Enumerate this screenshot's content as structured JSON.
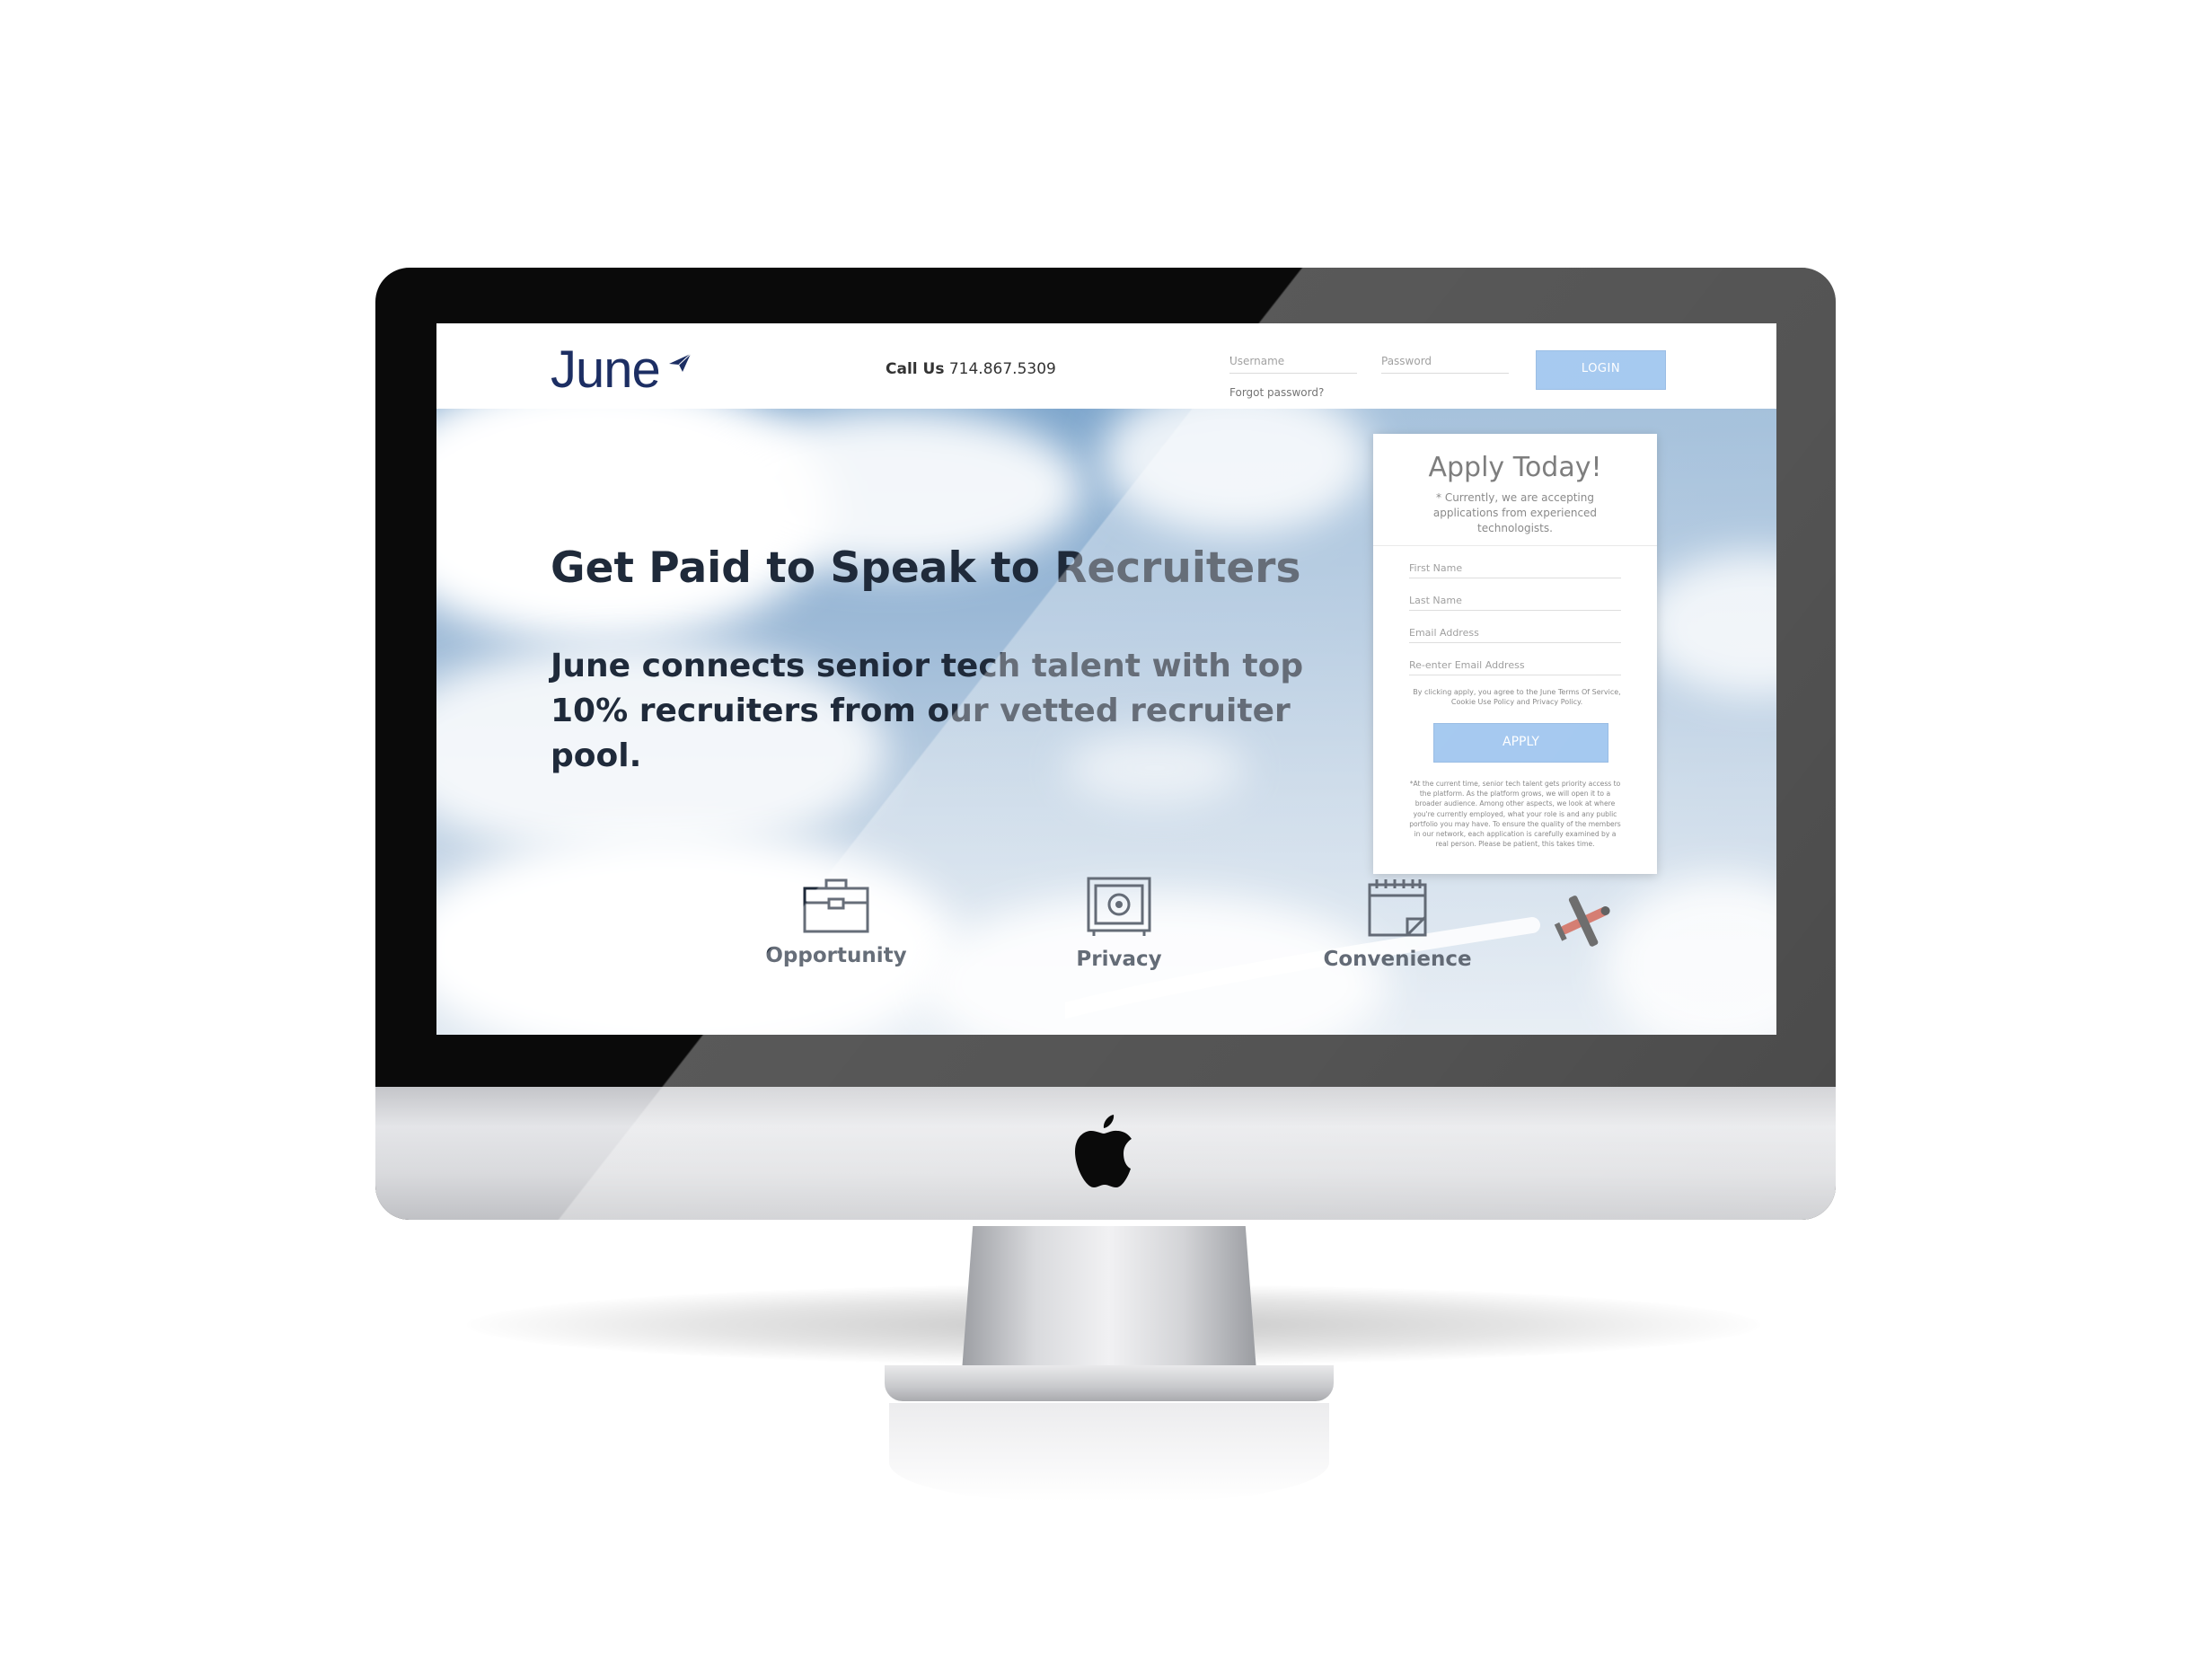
{
  "header": {
    "logo": "June",
    "call_us_label": "Call Us",
    "call_us_number": "714.867.5309",
    "username_placeholder": "Username",
    "password_placeholder": "Password",
    "forgot_password": "Forgot password?",
    "login_label": "LOGIN"
  },
  "hero": {
    "headline": "Get Paid to Speak to Recruiters",
    "subhead": "June connects senior tech talent with top 10% recruiters from our vetted recruiter pool."
  },
  "apply": {
    "title": "Apply Today!",
    "note": "* Currently, we are accepting applications from experienced technologists.",
    "first_name_placeholder": "First Name",
    "last_name_placeholder": "Last Name",
    "email_placeholder": "Email Address",
    "reenter_email_placeholder": "Re-enter Email Address",
    "terms": "By clicking apply, you agree to the June Terms Of Service, Cookie Use Policy and Privacy Policy.",
    "button_label": "APPLY",
    "fine_print": "*At the current time, senior tech talent gets priority access to the platform. As the platform grows, we will open it to a broader audience. Among other aspects, we look at where you're currently employed, what your role is and any public portfolio you may have. To ensure the quality of the members in our network, each application is carefully examined by a real person. Please be patient, this takes time."
  },
  "features": [
    {
      "label": "Opportunity",
      "icon": "briefcase-icon"
    },
    {
      "label": "Privacy",
      "icon": "safe-icon"
    },
    {
      "label": "Convenience",
      "icon": "calendar-icon"
    }
  ],
  "colors": {
    "brand_navy": "#1c2e63",
    "button_blue": "#7fb2ea",
    "text_dark": "#1f2a3a"
  }
}
